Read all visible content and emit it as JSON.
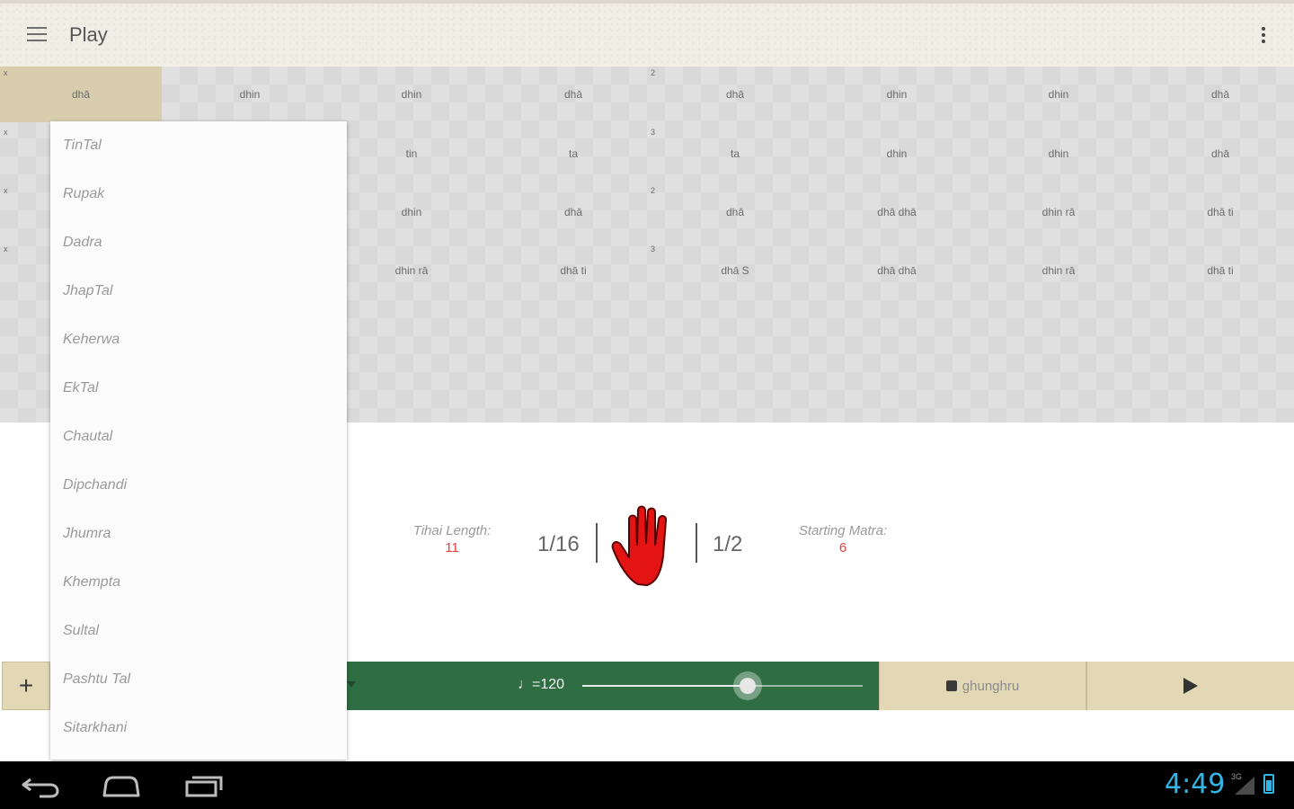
{
  "app": {
    "title": "Play"
  },
  "grid": {
    "rows": [
      {
        "marks": [
          "x",
          "",
          "",
          "",
          "2",
          "",
          "",
          ""
        ],
        "cells": [
          "dhā",
          "dhin",
          "dhin",
          "dhā",
          "dhā",
          "dhin",
          "dhin",
          "dhā"
        ]
      },
      {
        "marks": [
          "x",
          "",
          "",
          "",
          "3",
          "",
          "",
          ""
        ],
        "cells": [
          "",
          "",
          "tin",
          "ta",
          "ta",
          "dhin",
          "dhin",
          "dhā"
        ]
      },
      {
        "marks": [
          "x",
          "",
          "",
          "",
          "2",
          "",
          "",
          ""
        ],
        "cells": [
          "",
          "",
          "dhin",
          "dhā",
          "dhā",
          "dhā dhā",
          "dhin rā",
          "dhā ti"
        ]
      },
      {
        "marks": [
          "x",
          "",
          "",
          "",
          "3",
          "",
          "",
          ""
        ],
        "cells": [
          "",
          "",
          "dhin rā",
          "dhā ti",
          "dhā S",
          "dhā dhā",
          "dhin rā",
          "dhā ti"
        ]
      }
    ]
  },
  "tihai": {
    "length_label": "Tihai Length:",
    "length_value": "11",
    "fraction_left": "1/16",
    "fraction_right": "1/2",
    "start_label": "Starting Matra:",
    "start_value": "6"
  },
  "toolbar": {
    "add_label": "+",
    "tempo_label": "♩=120",
    "tempo_value": 120,
    "tempo_fraction": 0.59,
    "sound_label": "ghunghru"
  },
  "menu": {
    "items": [
      "TinTal",
      "Rupak",
      "Dadra",
      "JhapTal",
      "Keherwa",
      "EkTal",
      "Chautal",
      "Dipchandi",
      "Jhumra",
      "Khempta",
      "Sultal",
      "Pashtu Tal",
      "Sitarkhani"
    ]
  },
  "status": {
    "time": "4:49",
    "network": "3G"
  },
  "colors": {
    "accent_green": "#2e6e42",
    "tan": "#e3d8b6",
    "highlight_red": "#e74040",
    "clock_blue": "#33b5e5"
  }
}
